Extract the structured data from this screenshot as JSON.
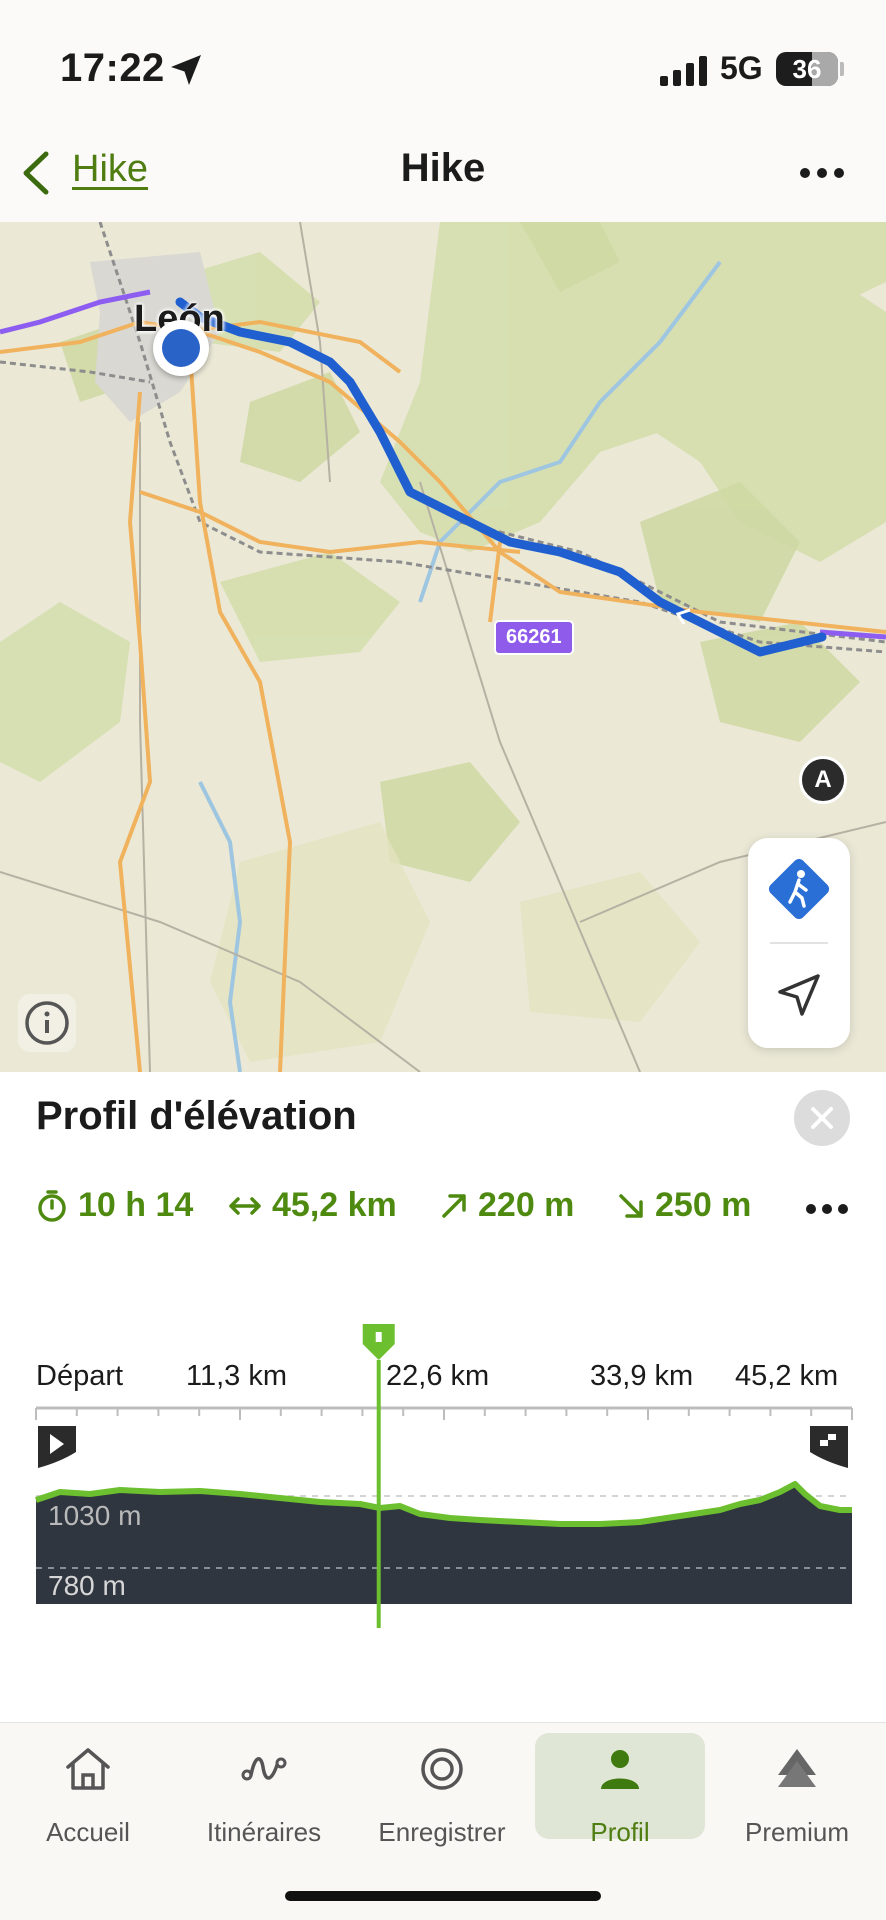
{
  "status_bar": {
    "time": "17:22",
    "network": "5G",
    "battery": "36"
  },
  "nav": {
    "back_label": "Hike",
    "title": "Hike"
  },
  "map": {
    "city_label": "León",
    "road_badge": "66261",
    "start_marker": "A"
  },
  "elevation": {
    "title": "Profil d'élévation",
    "stats": {
      "duration": "10 h 14",
      "distance": "45,2 km",
      "ascent": "220 m",
      "descent": "250 m"
    },
    "km_labels": [
      "Départ",
      "11,3 km",
      "22,6 km",
      "33,9 km",
      "45,2 km"
    ],
    "upper_level": "1030 m",
    "lower_level": "780 m",
    "cursor_fraction": 0.42
  },
  "tabs": [
    {
      "label": "Accueil",
      "icon": "home-icon"
    },
    {
      "label": "Itinéraires",
      "icon": "route-icon"
    },
    {
      "label": "Enregistrer",
      "icon": "record-icon"
    },
    {
      "label": "Profil",
      "icon": "profile-icon"
    },
    {
      "label": "Premium",
      "icon": "premium-icon"
    }
  ],
  "colors": {
    "accent": "#4f8a10",
    "route": "#1f5fcf",
    "profile_fill": "#2f3640",
    "profile_line": "#6cbf2e"
  }
}
